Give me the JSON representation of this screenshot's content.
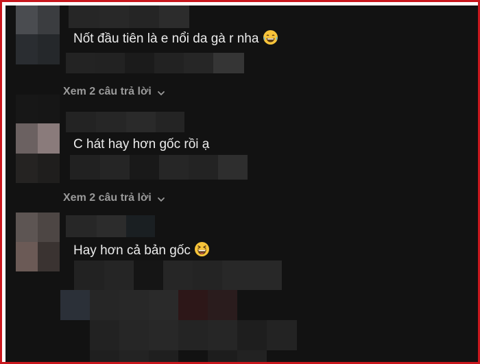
{
  "comments": [
    {
      "text": "Nốt đầu tiên là e nổi da gà r nha",
      "emoji": "tears-of-joy-emoji"
    },
    {
      "text": "C hát hay hơn gốc rồi ạ"
    },
    {
      "text": "Hay hơn cả bản gốc",
      "emoji": "squinting-laugh-emoji"
    }
  ],
  "replies": [
    {
      "label": "Xem 2 câu trả lời",
      "icon": "chevron-down-icon"
    },
    {
      "label": "Xem 2 câu trả lời",
      "icon": "chevron-down-icon"
    }
  ],
  "colors": {
    "background": "#121212",
    "frame_border": "#c8171d",
    "comment_text": "#ececec",
    "reply_text": "#9a9a9a"
  }
}
